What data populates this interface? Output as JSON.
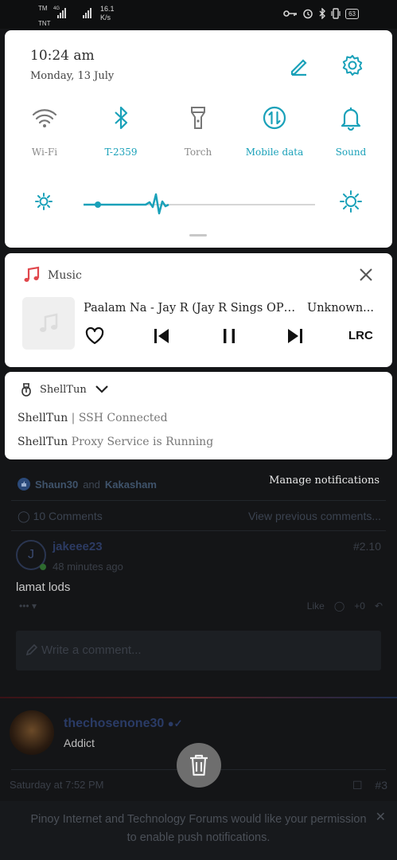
{
  "status_bar": {
    "network_top": "TM",
    "network_bottom": "TNT",
    "network_type": "4G",
    "speed_value": "16.1",
    "speed_unit": "K/s",
    "battery": "63"
  },
  "quick_settings": {
    "time": "10:24 am",
    "date": "Monday, 13 July",
    "tiles": [
      {
        "label": "Wi-Fi",
        "icon": "wifi-icon",
        "state": "off"
      },
      {
        "label": "T-2359",
        "icon": "bluetooth-icon",
        "state": "on"
      },
      {
        "label": "Torch",
        "icon": "torch-icon",
        "state": "off"
      },
      {
        "label": "Mobile data",
        "icon": "mobile-data-icon",
        "state": "on"
      },
      {
        "label": "Sound",
        "icon": "bell-icon",
        "state": "on"
      }
    ],
    "accent_color": "#1aa1b9"
  },
  "music": {
    "app_name": "Music",
    "song": "Paalam Na - Jay R (Jay R Sings OPM ...",
    "artist": "Unknown...",
    "lrc_label": "LRC"
  },
  "shelltun": {
    "app_name": "ShellTun",
    "line1_app": "ShellTun",
    "line1_text": "| SSH Connected",
    "line2_app": "ShellTun",
    "line2_text": "Proxy Service is Running"
  },
  "background_app": {
    "likers_a": "Shaun30",
    "likers_and": "and",
    "likers_b": "Kakasham",
    "manage_notifications": "Manage notifications",
    "comments_count": "10 Comments",
    "view_previous": "View previous comments...",
    "avatar_letter": "J",
    "username": "jakeee23",
    "post_number": "#2.10",
    "time_ago": "48 minutes ago",
    "comment_text": "lamat lods",
    "more_menu": "••• ▾",
    "like_label": "Like",
    "plus_count": "+0",
    "write_placeholder": "Write a comment...",
    "user2": "thechosenone30",
    "user2_title": "Addict",
    "post_time": "Saturday at 7:52 PM",
    "post_index": "#3",
    "permission_line1": "Pinoy Internet and Technology Forums would like your permission",
    "permission_line2": "to enable push notifications."
  }
}
